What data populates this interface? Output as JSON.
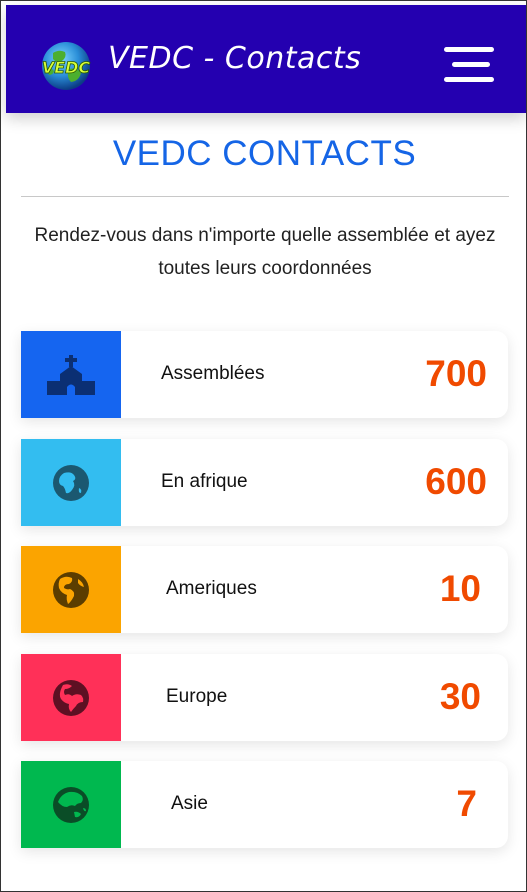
{
  "header": {
    "title": "VEDC - Contacts",
    "logo_text": "VEDC"
  },
  "main": {
    "title": "VEDC CONTACTS",
    "intro": "Rendez-vous dans n'importe quelle assemblée et ayez toutes leurs coordonnées"
  },
  "cards": [
    {
      "label": "Assemblées",
      "value": "700",
      "icon": "church-icon",
      "color": "#1565f0",
      "icon_color": "#0b2f73"
    },
    {
      "label": "En afrique",
      "value": "600",
      "icon": "globe-africa-icon",
      "color": "#33bdf0",
      "icon_color": "#1b5870"
    },
    {
      "label": "Ameriques",
      "value": "10",
      "icon": "globe-americas-icon",
      "color": "#fba400",
      "icon_color": "#5b3d00"
    },
    {
      "label": "Europe",
      "value": "30",
      "icon": "globe-europe-icon",
      "color": "#ff3058",
      "icon_color": "#5e1023"
    },
    {
      "label": "Asie",
      "value": "7",
      "icon": "globe-asia-icon",
      "color": "#00b84f",
      "icon_color": "#0a4d27"
    }
  ],
  "colors": {
    "header_bg": "#2400b0",
    "title_blue": "#1565e6",
    "value_orange": "#f04a00"
  }
}
